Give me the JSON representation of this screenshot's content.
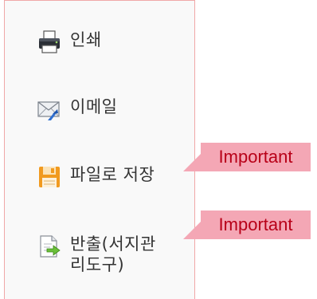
{
  "menu": {
    "items": [
      {
        "label": "인쇄",
        "icon": "printer-icon"
      },
      {
        "label": "이메일",
        "icon": "email-icon"
      },
      {
        "label": "파일로 저장",
        "icon": "save-file-icon"
      },
      {
        "label": "반출(서지관\n리도구)",
        "icon": "export-icon"
      }
    ]
  },
  "annotations": {
    "first": "Important",
    "second": "Important"
  },
  "colors": {
    "tag_fill": "#f4a7b5",
    "tag_text": "#b80018",
    "panel_border": "#f0a8a8"
  }
}
